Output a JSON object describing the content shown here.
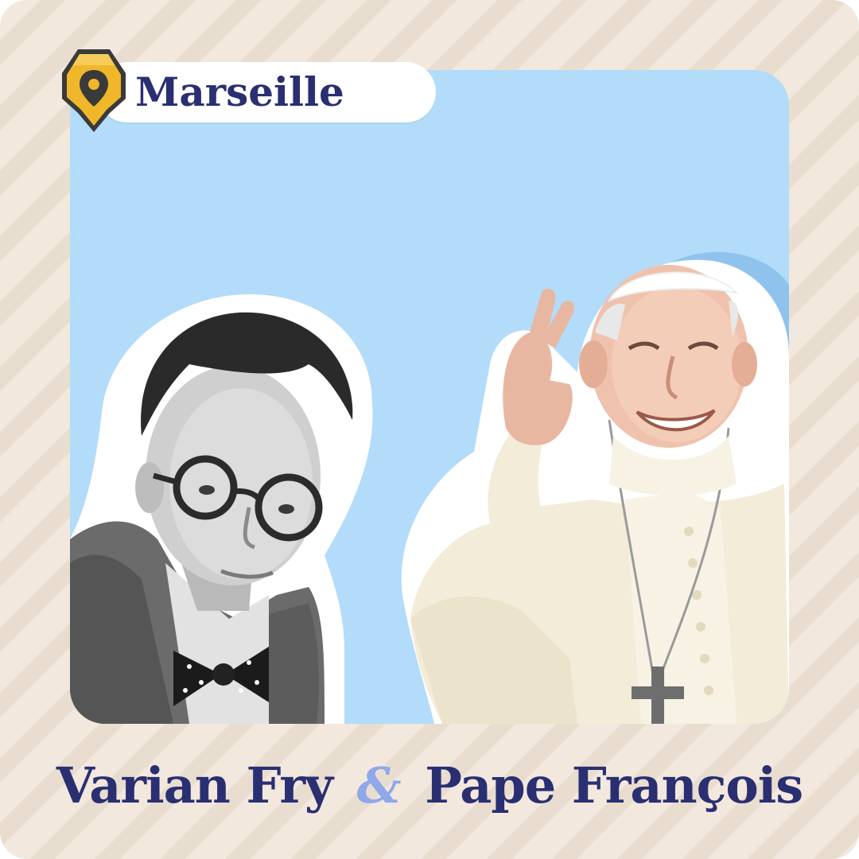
{
  "location": {
    "label": "Marseille",
    "icon": "map-pin-icon",
    "pin_color": "#f1b72a",
    "pin_shadow": "#3a3a3a"
  },
  "caption": {
    "person_left": "Varian Fry",
    "connector": "&",
    "person_right": "Pape François"
  },
  "colors": {
    "background": "#f2e8dd",
    "stripe": "#e9ddd0",
    "panel": "#b2dcf9",
    "text": "#2a2f72",
    "accent": "#8fa8ea"
  },
  "images": {
    "left_portrait": "black-and-white-portrait-man-round-glasses-bow-tie",
    "right_portrait": "smiling-man-white-cassock-skullcap-waving"
  }
}
